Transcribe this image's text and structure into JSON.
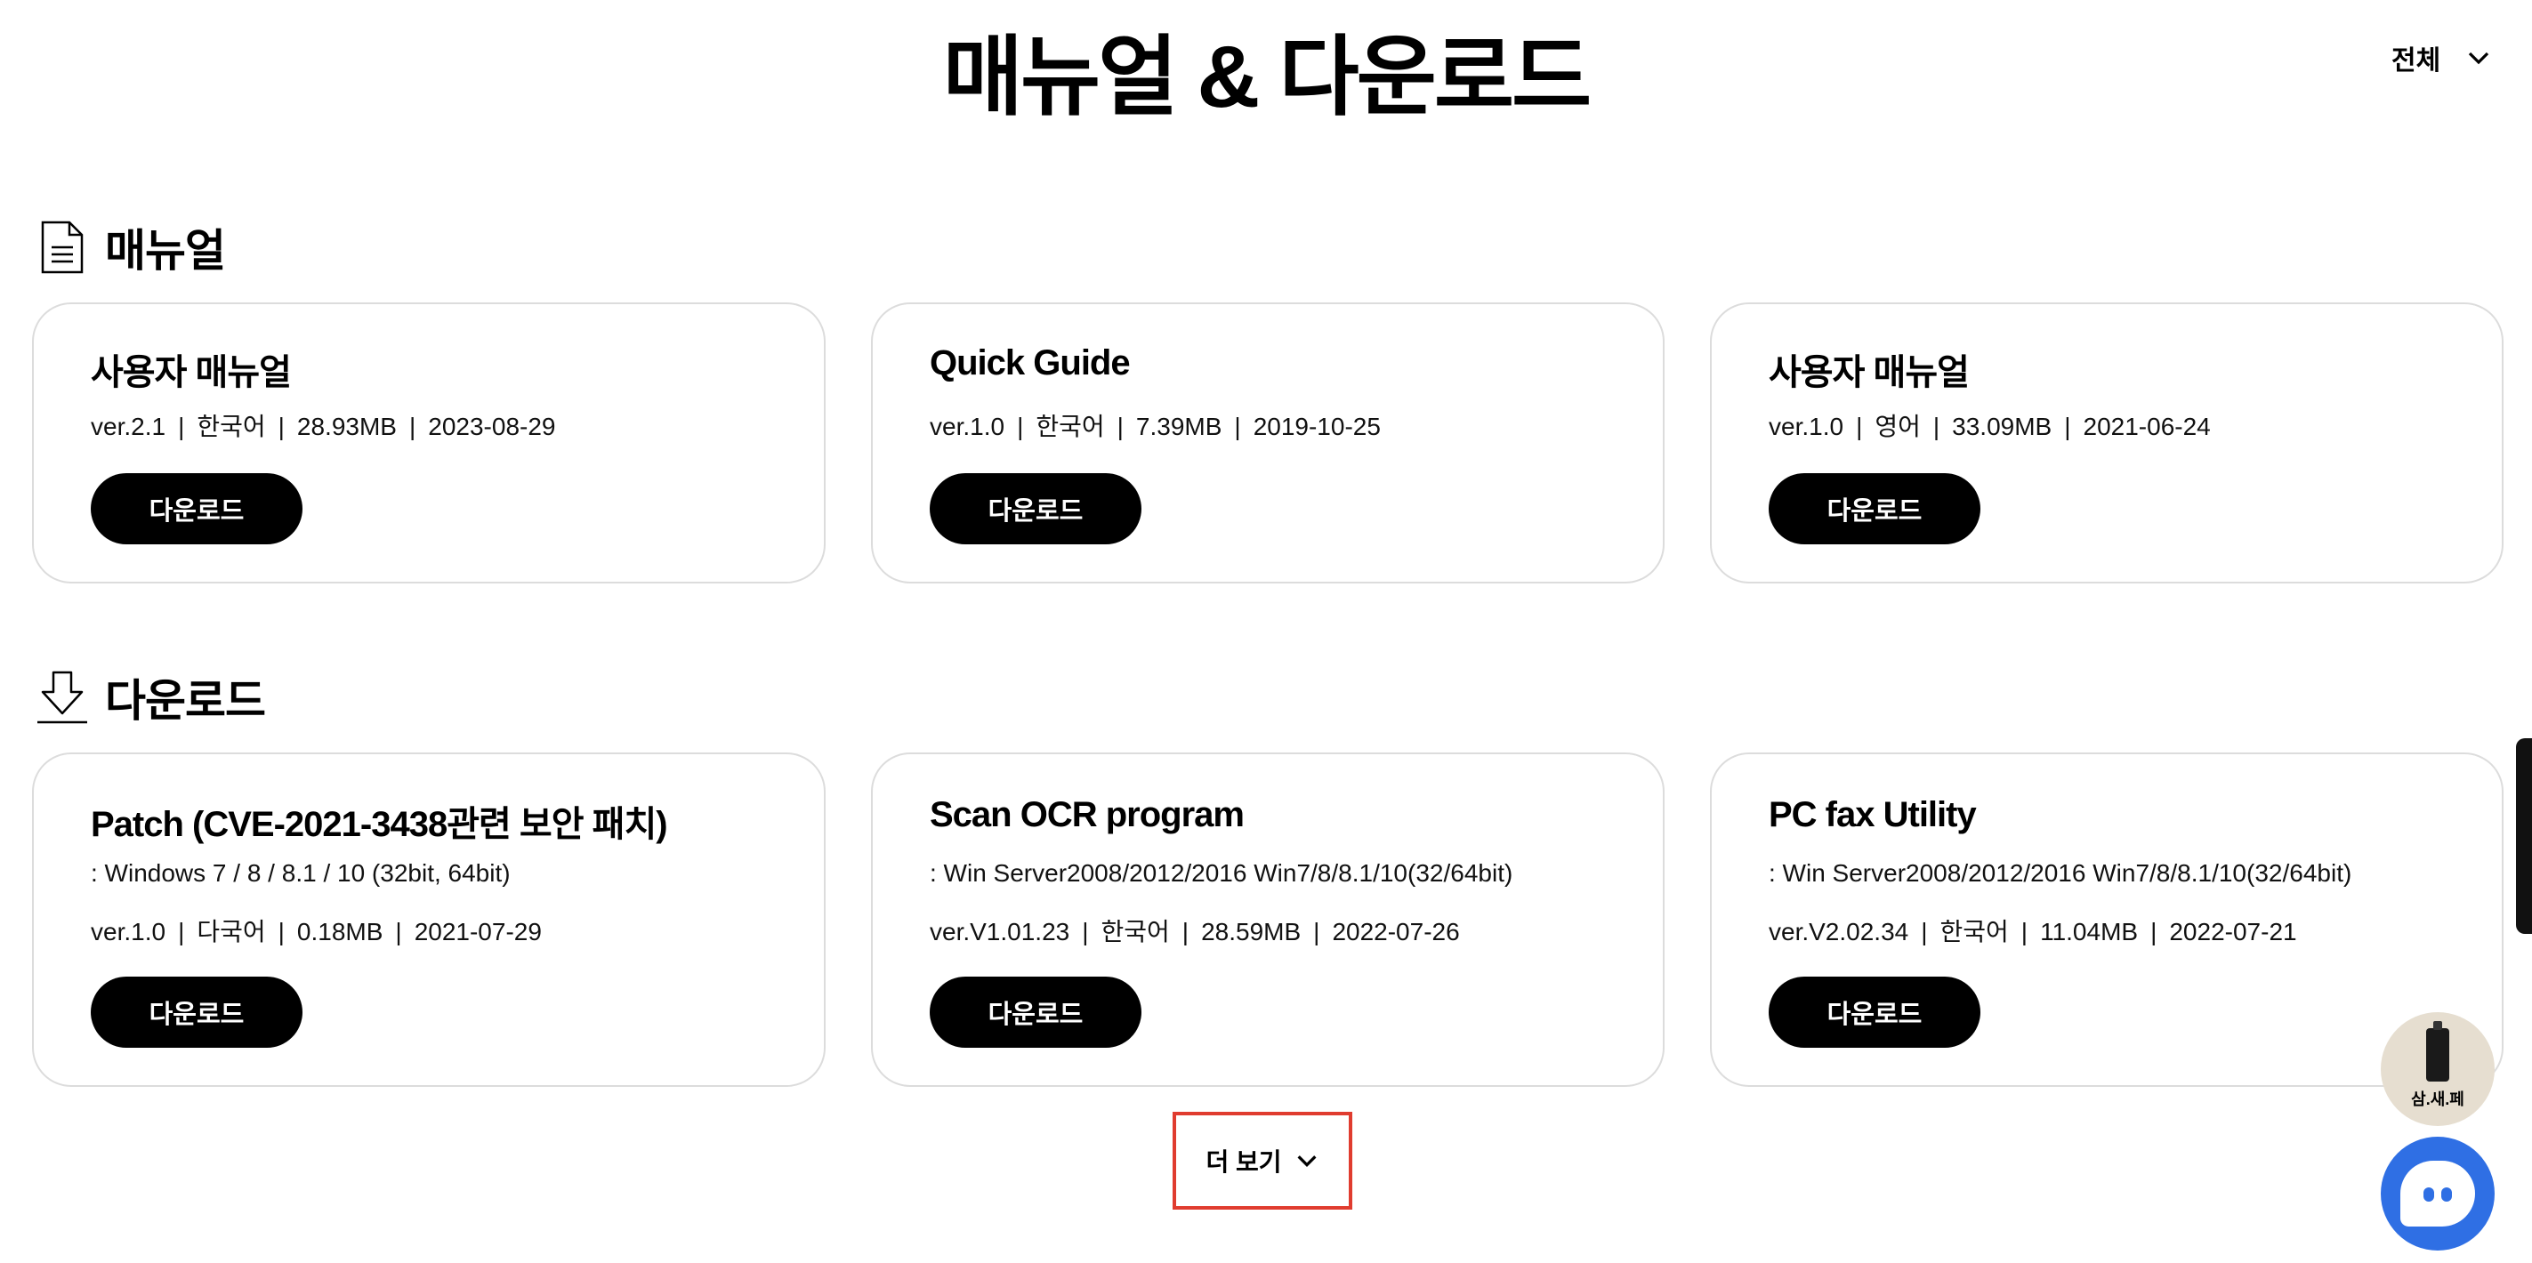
{
  "header": {
    "title": "매뉴얼 & 다운로드",
    "filter": {
      "selected": "전체",
      "icon": "chevron-down-icon"
    }
  },
  "manuals": {
    "section_title": "매뉴얼",
    "icon": "document-icon",
    "items": [
      {
        "title": "사용자 매뉴얼",
        "version": "ver.2.1",
        "language": "한국어",
        "size": "28.93MB",
        "date": "2023-08-29",
        "button": "다운로드"
      },
      {
        "title": "Quick Guide",
        "version": "ver.1.0",
        "language": "한국어",
        "size": "7.39MB",
        "date": "2019-10-25",
        "button": "다운로드"
      },
      {
        "title": "사용자 매뉴얼",
        "version": "ver.1.0",
        "language": "영어",
        "size": "33.09MB",
        "date": "2021-06-24",
        "button": "다운로드"
      }
    ]
  },
  "downloads": {
    "section_title": "다운로드",
    "icon": "download-icon",
    "items": [
      {
        "title": "Patch (CVE-2021-3438관련 보안 패치)",
        "subtitle": ": Windows 7 / 8 / 8.1 / 10 (32bit, 64bit)",
        "version": "ver.1.0",
        "language": "다국어",
        "size": "0.18MB",
        "date": "2021-07-29",
        "button": "다운로드"
      },
      {
        "title": "Scan OCR program",
        "subtitle": ": Win Server2008/2012/2016 Win7/8/8.1/10(32/64bit)",
        "version": "ver.V1.01.23",
        "language": "한국어",
        "size": "28.59MB",
        "date": "2022-07-26",
        "button": "다운로드"
      },
      {
        "title": "PC fax Utility",
        "subtitle": ": Win Server2008/2012/2016 Win7/8/8.1/10(32/64bit)",
        "version": "ver.V2.02.34",
        "language": "한국어",
        "size": "11.04MB",
        "date": "2022-07-21",
        "button": "다운로드"
      }
    ]
  },
  "more": {
    "label": "더 보기",
    "icon": "chevron-down-icon"
  },
  "floating": {
    "sasepe_label": "삼.새.페"
  },
  "colors": {
    "button_bg": "#000000",
    "highlight_border": "#e03c2f",
    "chatbot_bg": "#2f6fe4",
    "card_border": "#dcdcdc"
  }
}
